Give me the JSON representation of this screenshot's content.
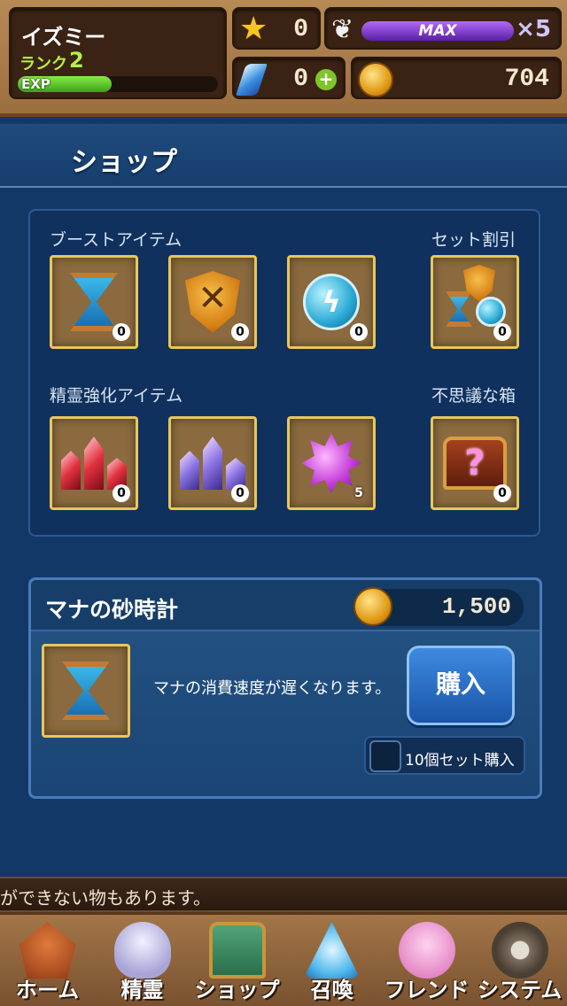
{
  "header": {
    "player_name": "イズミー",
    "rank_label": "ランク",
    "rank_value": "2",
    "exp_label": "EXP",
    "exp_progress_percent": 47,
    "stars": "0",
    "stamina_label": "MAX",
    "stamina_multiplier": "×5",
    "crystals": "0",
    "coins": "704",
    "icons": {
      "star": "star-icon",
      "wing": "wing-icon",
      "crystal": "crystal-icon",
      "plus": "plus-icon",
      "coin": "coin-icon"
    }
  },
  "page": {
    "title": "ショップ"
  },
  "shop": {
    "boost_label": "ブーストアイテム",
    "set_discount_label": "セット割引",
    "spirit_label": "精霊強化アイテム",
    "mystery_label": "不思議な箱",
    "items": [
      {
        "name": "mana-hourglass",
        "count": "0"
      },
      {
        "name": "shield",
        "count": "0"
      },
      {
        "name": "lightning-potion",
        "count": "0"
      },
      {
        "name": "boost-set",
        "count": "0"
      },
      {
        "name": "red-crystal",
        "count": "0"
      },
      {
        "name": "blue-crystal",
        "count": "0"
      },
      {
        "name": "purple-star-crystal",
        "count": "5"
      },
      {
        "name": "mystery-box",
        "count": "0"
      }
    ]
  },
  "detail": {
    "title": "マナの砂時計",
    "price": "1,500",
    "description": "マナの消費速度が遅くなります。",
    "buy_label": "購入",
    "bulk_label": "10個セット購入"
  },
  "ticker": {
    "text": "ができない物もあります。"
  },
  "nav": {
    "home": "ホーム",
    "spirit": "精霊",
    "shop": "ショップ",
    "summon": "召喚",
    "friend": "フレンド",
    "system": "システム"
  },
  "colors": {
    "background": "#123868",
    "accent_gold": "#e8c75a",
    "exp_green": "#87ec44",
    "stamina_purple": "#b36af6",
    "buy_blue": "#3e8ae0"
  }
}
